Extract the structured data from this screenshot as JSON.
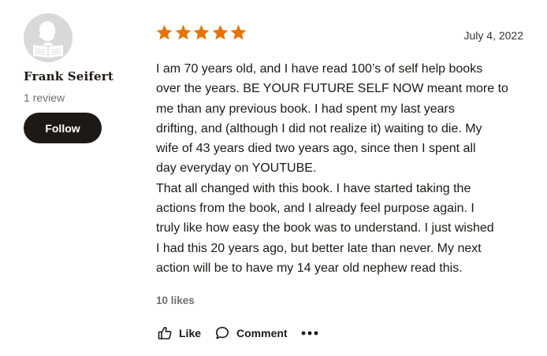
{
  "author": {
    "name": "Frank Seifert",
    "review_count": "1 review",
    "follow_label": "Follow"
  },
  "review": {
    "rating": 5,
    "rating_max": 5,
    "star_color": "#e87400",
    "date": "July 4, 2022",
    "lines": [
      "I am 70 years old, and I have read 100’s of self help books",
      "over the years. BE YOUR FUTURE SELF NOW meant more to",
      "me than any previous book. I had spent my last years",
      "drifting, and (although I did not realize it) waiting to die. My",
      "wife of 43 years died two years ago, since then I spent all",
      "day everyday on YOUTUBE.",
      "That all changed with this book. I have started taking the",
      "actions from the book, and I already feel purpose again. I",
      "truly like how easy the book was to understand. I just wished",
      "I had this 20 years ago, but better late than never. My next",
      "action will be to have my 14 year old nephew read this."
    ],
    "likes": "10 likes"
  },
  "actions": {
    "like_label": "Like",
    "comment_label": "Comment"
  },
  "icons": {
    "avatar": "default-user-avatar-icon",
    "like": "thumbs-up-icon",
    "comment": "speech-bubble-icon",
    "more": "more-dots-icon"
  }
}
